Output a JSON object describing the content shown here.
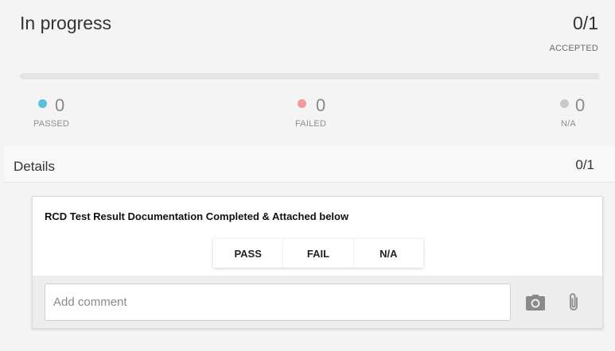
{
  "summary": {
    "status": "In progress",
    "count": "0/1",
    "count_label": "ACCEPTED",
    "progress_fraction": 0,
    "stats": {
      "passed": {
        "value": "0",
        "label": "PASSED",
        "color": "#5bc0de"
      },
      "failed": {
        "value": "0",
        "label": "FAILED",
        "color": "#f29a9a"
      },
      "na": {
        "value": "0",
        "label": "N/A",
        "color": "#c8c8c8"
      }
    }
  },
  "details": {
    "title": "Details",
    "count": "0/1"
  },
  "item": {
    "title": "RCD Test Result Documentation Completed & Attached below",
    "options": [
      "PASS",
      "FAIL",
      "N/A"
    ],
    "comment": {
      "value": "",
      "placeholder": "Add comment"
    },
    "icons": [
      "camera-icon",
      "paperclip-icon"
    ]
  }
}
